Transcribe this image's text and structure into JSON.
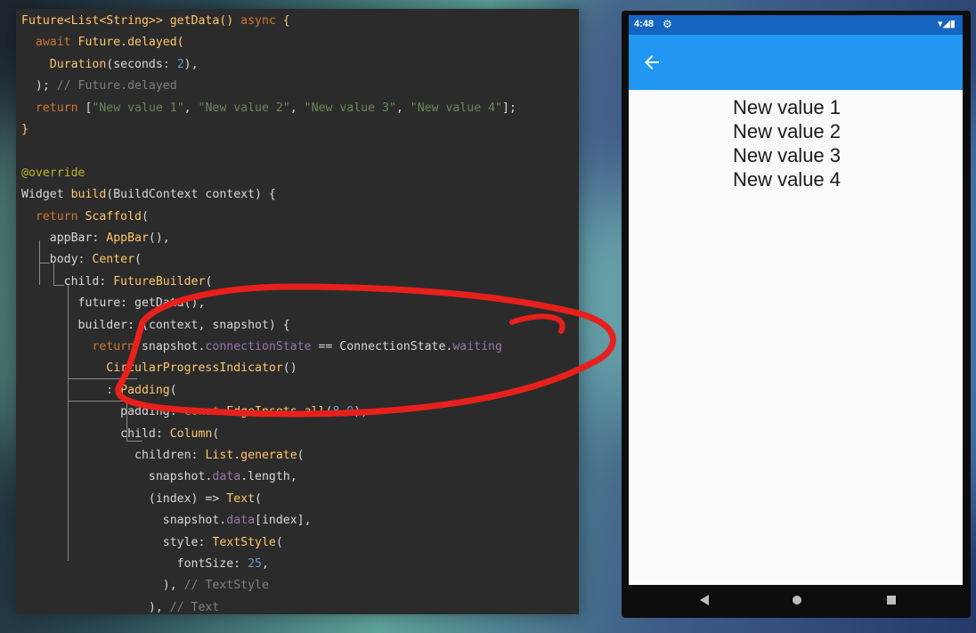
{
  "code": {
    "lines": [
      [
        [
          "fn",
          "Future<List<String>> getData() "
        ],
        [
          "kw",
          "async"
        ],
        [
          "fn",
          " {"
        ]
      ],
      [
        [
          "pl",
          "  "
        ],
        [
          "kw",
          "await "
        ],
        [
          "fn",
          "Future.delayed("
        ]
      ],
      [
        [
          "pl",
          "    "
        ],
        [
          "fn",
          "Duration"
        ],
        [
          "pl",
          "(seconds: "
        ],
        [
          "num",
          "2"
        ],
        [
          "pl",
          "),"
        ]
      ],
      [
        [
          "pl",
          "  ); "
        ],
        [
          "cm",
          "// Future.delayed"
        ]
      ],
      [
        [
          "pl",
          "  "
        ],
        [
          "kw",
          "return "
        ],
        [
          "pl",
          "["
        ],
        [
          "str",
          "\"New value 1\""
        ],
        [
          "pl",
          ", "
        ],
        [
          "str",
          "\"New value 2\""
        ],
        [
          "pl",
          ", "
        ],
        [
          "str",
          "\"New value 3\""
        ],
        [
          "pl",
          ", "
        ],
        [
          "str",
          "\"New value 4\""
        ],
        [
          "pl",
          "];"
        ]
      ],
      [
        [
          "fn",
          "}"
        ]
      ],
      [
        [
          "pl",
          ""
        ]
      ],
      [
        [
          "ann",
          "@override"
        ]
      ],
      [
        [
          "pl",
          "Widget "
        ],
        [
          "fn",
          "build"
        ],
        [
          "pl",
          "(BuildContext context) {"
        ]
      ],
      [
        [
          "pl",
          "  "
        ],
        [
          "kw",
          "return "
        ],
        [
          "fn",
          "Scaffold"
        ],
        [
          "pl",
          "("
        ]
      ],
      [
        [
          "pl",
          "    appBar: "
        ],
        [
          "fn",
          "AppBar"
        ],
        [
          "pl",
          "(),"
        ]
      ],
      [
        [
          "pl",
          "    body: "
        ],
        [
          "fn",
          "Center"
        ],
        [
          "pl",
          "("
        ]
      ],
      [
        [
          "pl",
          "      child: "
        ],
        [
          "fn",
          "FutureBuilder"
        ],
        [
          "pl",
          "("
        ]
      ],
      [
        [
          "pl",
          "        future: getData(),"
        ]
      ],
      [
        [
          "pl",
          "        builder: (context, snapshot) {"
        ]
      ],
      [
        [
          "pl",
          "          "
        ],
        [
          "kw",
          "return "
        ],
        [
          "pl",
          "snapshot."
        ],
        [
          "prop",
          "connectionState"
        ],
        [
          "pl",
          " == ConnectionState."
        ],
        [
          "prop",
          "waiting"
        ]
      ],
      [
        [
          "pl",
          "            "
        ],
        [
          "fn",
          "CircularProgressIndicator"
        ],
        [
          "pl",
          "()"
        ]
      ],
      [
        [
          "pl",
          "            : "
        ],
        [
          "fn",
          "Padding"
        ],
        [
          "pl",
          "("
        ]
      ],
      [
        [
          "pl",
          "              padding: "
        ],
        [
          "kw",
          "const "
        ],
        [
          "fn",
          "EdgeInsets.all"
        ],
        [
          "pl",
          "("
        ],
        [
          "num",
          "8.0"
        ],
        [
          "pl",
          "),"
        ]
      ],
      [
        [
          "pl",
          "              child: "
        ],
        [
          "fn",
          "Column"
        ],
        [
          "pl",
          "("
        ]
      ],
      [
        [
          "pl",
          "                children: "
        ],
        [
          "fn",
          "List.generate"
        ],
        [
          "pl",
          "("
        ]
      ],
      [
        [
          "pl",
          "                  snapshot."
        ],
        [
          "prop",
          "data"
        ],
        [
          "pl",
          ".length,"
        ]
      ],
      [
        [
          "pl",
          "                  (index) => "
        ],
        [
          "fn",
          "Text"
        ],
        [
          "pl",
          "("
        ]
      ],
      [
        [
          "pl",
          "                    snapshot."
        ],
        [
          "prop",
          "data"
        ],
        [
          "pl",
          "[index],"
        ]
      ],
      [
        [
          "pl",
          "                    style: "
        ],
        [
          "fn",
          "TextStyle"
        ],
        [
          "pl",
          "("
        ]
      ],
      [
        [
          "pl",
          "                      fontSize: "
        ],
        [
          "num",
          "25"
        ],
        [
          "pl",
          ","
        ]
      ],
      [
        [
          "pl",
          "                    ), "
        ],
        [
          "cm",
          "// TextStyle"
        ]
      ],
      [
        [
          "pl",
          "                  ), "
        ],
        [
          "cm",
          "// Text"
        ]
      ]
    ]
  },
  "phone": {
    "status_bar": {
      "time": "4:48"
    },
    "app_bar_color": "#2196f3",
    "status_bar_color": "#1565c0",
    "values": [
      "New value 1",
      "New value 2",
      "New value 3",
      "New value 4"
    ]
  },
  "annotation": {
    "color": "#e8201c"
  }
}
